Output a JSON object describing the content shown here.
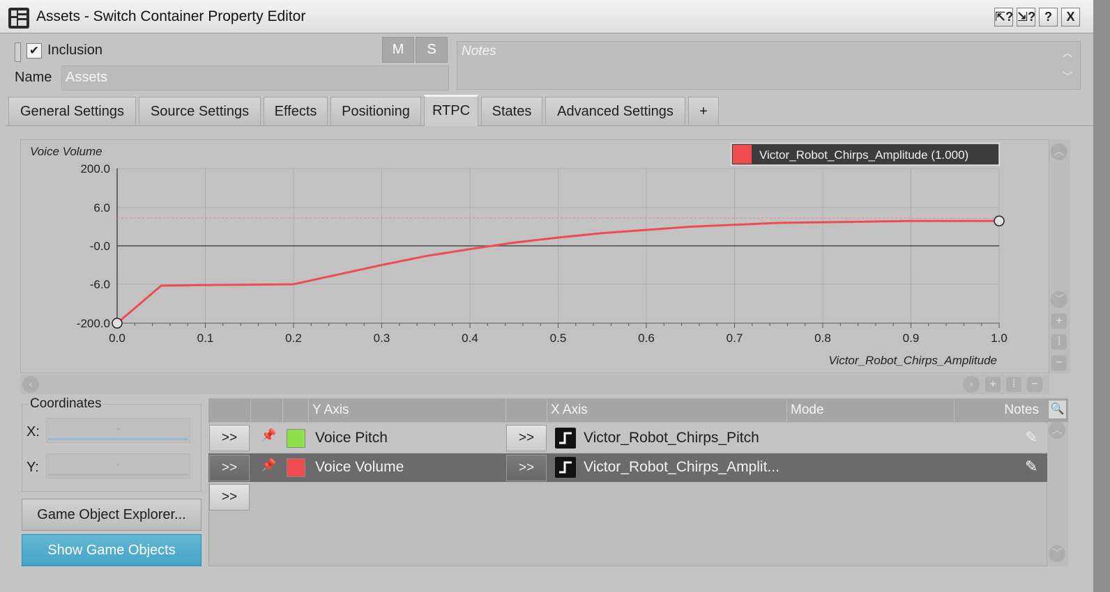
{
  "window": {
    "title": "Assets - Switch Container Property Editor",
    "buttons": [
      "?",
      "?",
      "?",
      "X"
    ]
  },
  "header": {
    "inclusion_label": "Inclusion",
    "inclusion_checked": true,
    "m_label": "M",
    "s_label": "S",
    "name_label": "Name",
    "name_value": "Assets",
    "notes_placeholder": "Notes"
  },
  "tabs": [
    {
      "label": "General Settings"
    },
    {
      "label": "Source Settings"
    },
    {
      "label": "Effects"
    },
    {
      "label": "Positioning"
    },
    {
      "label": "RTPC",
      "active": true
    },
    {
      "label": "States"
    },
    {
      "label": "Advanced Settings"
    },
    {
      "label": "+"
    }
  ],
  "chart_data": {
    "type": "line",
    "ylabel": "Voice Volume",
    "xlabel": "Victor_Robot_Chirps_Amplitude",
    "y_tick_labels": [
      "200.0",
      "6.0",
      "-0.0",
      "-6.0",
      "-200.0"
    ],
    "x_tick_labels": [
      "0.0",
      "0.1",
      "0.2",
      "0.3",
      "0.4",
      "0.5",
      "0.6",
      "0.7",
      "0.8",
      "0.9",
      "1.0"
    ],
    "xlim": [
      0.0,
      1.0
    ],
    "grid": true,
    "legend": "top-right",
    "series": [
      {
        "name": "Victor_Robot_Chirps_Amplitude (1.000)",
        "color": "#f04b4f",
        "points": [
          [
            0.0,
            -200.0
          ],
          [
            0.05,
            -13.2
          ],
          [
            0.1,
            -10.6
          ],
          [
            0.15,
            -8.3
          ],
          [
            0.2,
            -6.3
          ],
          [
            0.25,
            -4.5
          ],
          [
            0.3,
            -3.0
          ],
          [
            0.35,
            -1.6
          ],
          [
            0.4,
            -0.5
          ],
          [
            0.45,
            0.5
          ],
          [
            0.5,
            1.3
          ],
          [
            0.55,
            2.0
          ],
          [
            0.6,
            2.5
          ],
          [
            0.65,
            3.0
          ],
          [
            0.7,
            3.3
          ],
          [
            0.75,
            3.6
          ],
          [
            0.8,
            3.7
          ],
          [
            0.85,
            3.8
          ],
          [
            0.9,
            3.9
          ],
          [
            0.95,
            3.9
          ],
          [
            1.0,
            3.9
          ]
        ]
      }
    ]
  },
  "coordinates": {
    "title": "Coordinates",
    "x_label": "X:",
    "y_label": "Y:",
    "x_value": "-",
    "y_value": "-"
  },
  "buttons": {
    "game_object_explorer": "Game Object Explorer...",
    "show_game_objects": "Show Game Objects"
  },
  "rtpc_table": {
    "columns": [
      "Y Axis",
      "X Axis",
      "Mode",
      "Notes"
    ],
    "expand_label": ">>",
    "rows": [
      {
        "y_axis": "Voice Pitch",
        "color": "#8ee04a",
        "x_axis": "Victor_Robot_Chirps_Pitch",
        "selected": false
      },
      {
        "y_axis": "Voice Volume",
        "color": "#f04b4f",
        "x_axis": "Victor_Robot_Chirps_Amplit...",
        "selected": true
      }
    ]
  },
  "colors": {
    "curve": "#f04b4f",
    "accent_button": "#4fa9cb",
    "selected_row": "#6b6b6b"
  }
}
